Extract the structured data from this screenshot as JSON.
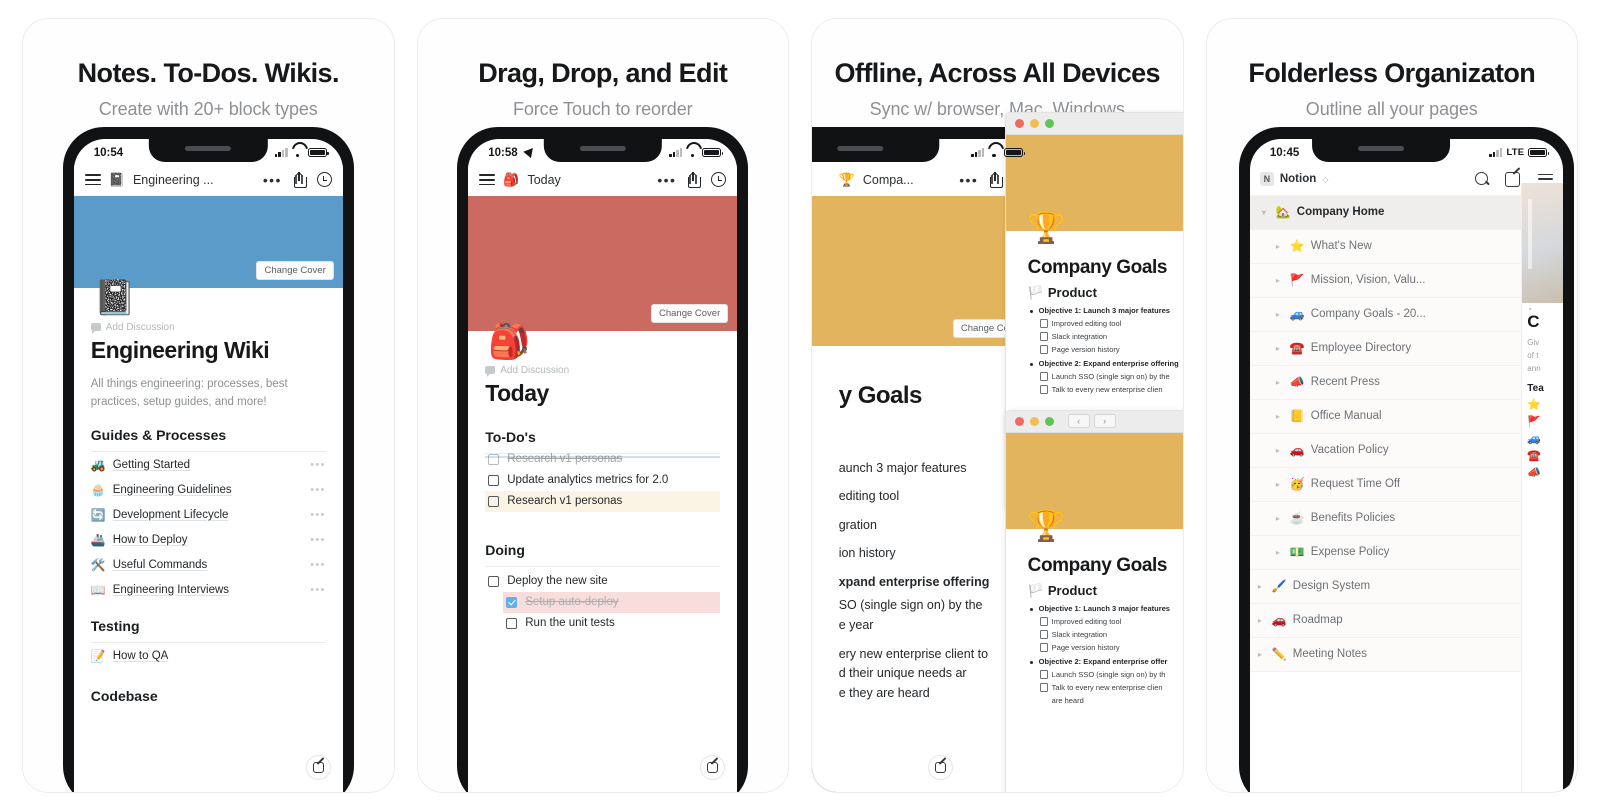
{
  "panels": [
    {
      "title": "Notes. To-Dos. Wikis.",
      "subtitle": "Create with 20+ block types",
      "phone": {
        "time": "10:54",
        "carrier_label": "",
        "nav_title": "Engineering ...",
        "nav_emoji": "📓",
        "cover_color": "#5b9bc9",
        "change_cover": "Change Cover",
        "page_emoji": "📓",
        "add_discussion": "Add Discussion",
        "page_title": "Engineering Wiki",
        "description": "All things engineering: processes, best practices, setup guides, and more!",
        "section1": "Guides & Processes",
        "links": [
          {
            "emoji": "🚜",
            "label": "Getting Started"
          },
          {
            "emoji": "🧁",
            "label": "Engineering Guidelines"
          },
          {
            "emoji": "🔄",
            "label": "Development Lifecycle"
          },
          {
            "emoji": "🚢",
            "label": "How to Deploy"
          },
          {
            "emoji": "🛠️",
            "label": "Useful Commands"
          },
          {
            "emoji": "📖",
            "label": "Engineering Interviews"
          }
        ],
        "section2": "Testing",
        "links2": [
          {
            "emoji": "📝",
            "label": "How to QA"
          }
        ],
        "section3": "Codebase"
      }
    },
    {
      "title": "Drag, Drop, and Edit",
      "subtitle": "Force Touch to reorder",
      "phone": {
        "time": "10:58",
        "nav_title": "Today",
        "nav_emoji": "🎒",
        "cover_color": "#cb6a61",
        "change_cover": "Change Cover",
        "page_emoji": "🎒",
        "add_discussion": "Add Discussion",
        "page_title": "Today",
        "section1": "To-Do's",
        "drag_ghost": "Research v1 personas",
        "todos1": [
          {
            "label": "Update analytics metrics for 2.0",
            "checked": false,
            "highlight": "none"
          },
          {
            "label": "Research v1 personas",
            "checked": false,
            "highlight": "yellow"
          }
        ],
        "section2": "Doing",
        "todos2": [
          {
            "label": "Deploy the new site",
            "checked": false,
            "highlight": "none",
            "indent": false
          },
          {
            "label": "Setup auto-deploy",
            "checked": true,
            "highlight": "red",
            "indent": true,
            "struck": true
          },
          {
            "label": "Run the unit tests",
            "checked": false,
            "highlight": "none",
            "indent": true
          }
        ]
      }
    },
    {
      "title": "Offline, Across All Devices",
      "subtitle": "Sync w/ browser, Mac, Windows",
      "phone": {
        "nav_title": "Compa...",
        "nav_emoji": "🏆",
        "cover_color": "#e3b45e",
        "change_cover": "Change Cover",
        "page_title_visible": "y Goals",
        "lines": [
          "aunch 3 major features",
          "editing tool",
          "gration",
          "ion history",
          "xpand enterprise offering",
          "SO (single sign on) by the",
          "e year",
          "ery new enterprise client to",
          "d their unique needs ar",
          "e they are heard"
        ]
      },
      "windows": [
        {
          "cover_color": "#e3b45e",
          "emoji": "🏆",
          "heading": "Company Goals",
          "sub_emoji": "🏳️",
          "subheading": "Product",
          "items": [
            {
              "type": "bullet",
              "text": "Objective 1: Launch 3 major features"
            },
            {
              "type": "check",
              "text": "Improved editing tool"
            },
            {
              "type": "check",
              "text": "Slack integration"
            },
            {
              "type": "check",
              "text": "Page version history"
            },
            {
              "type": "bullet",
              "text": "Objective 2: Expand enterprise offering"
            },
            {
              "type": "check",
              "text": "Launch SSO (single sign on) by the"
            },
            {
              "type": "check",
              "text": "Talk to every new enterprise clien"
            }
          ],
          "has_navbtns": false
        },
        {
          "cover_color": "#e3b45e",
          "emoji": "🏆",
          "heading": "Company Goals",
          "sub_emoji": "🏳️",
          "subheading": "Product",
          "back_label": "‹",
          "fwd_label": "›",
          "items": [
            {
              "type": "bullet",
              "text": "Objective 1: Launch 3 major features"
            },
            {
              "type": "check",
              "text": "Improved editing tool"
            },
            {
              "type": "check",
              "text": "Slack integration"
            },
            {
              "type": "check",
              "text": "Page version history"
            },
            {
              "type": "bullet",
              "text": "Objective 2: Expand enterprise offer"
            },
            {
              "type": "check",
              "text": "Launch SSO (single sign on) by th"
            },
            {
              "type": "check",
              "text": "Talk to every new enterprise clien"
            },
            {
              "type": "cont",
              "text": "are heard"
            }
          ],
          "has_navbtns": true
        }
      ]
    },
    {
      "title": "Folderless Organizaton",
      "subtitle": "Outline all your pages",
      "phone": {
        "time": "10:45",
        "carrier_label": "LTE",
        "workspace_badge": "N",
        "workspace_name": "Notion",
        "tree": [
          {
            "emoji": "🏡",
            "label": "Company Home",
            "level": 0,
            "root": true,
            "expanded": true
          },
          {
            "emoji": "⭐",
            "label": "What's New",
            "level": 1,
            "root": false,
            "expanded": false
          },
          {
            "emoji": "🚩",
            "label": "Mission, Vision, Valu...",
            "level": 1,
            "root": false,
            "expanded": false
          },
          {
            "emoji": "🚙",
            "label": "Company Goals - 20...",
            "level": 1,
            "root": false,
            "expanded": false
          },
          {
            "emoji": "☎️",
            "label": "Employee Directory",
            "level": 1,
            "root": false,
            "expanded": false
          },
          {
            "emoji": "📣",
            "label": "Recent Press",
            "level": 1,
            "root": false,
            "expanded": false
          },
          {
            "emoji": "📒",
            "label": "Office Manual",
            "level": 1,
            "root": false,
            "expanded": false
          },
          {
            "emoji": "🚗",
            "label": "Vacation Policy",
            "level": 1,
            "root": false,
            "expanded": false
          },
          {
            "emoji": "🥳",
            "label": "Request Time Off",
            "level": 1,
            "root": false,
            "expanded": false
          },
          {
            "emoji": "☕",
            "label": "Benefits Policies",
            "level": 1,
            "root": false,
            "expanded": false
          },
          {
            "emoji": "💵",
            "label": "Expense Policy",
            "level": 1,
            "root": false,
            "expanded": false
          },
          {
            "emoji": "🖌️",
            "label": "Design System",
            "level": 0,
            "root": false,
            "expanded": false
          },
          {
            "emoji": "🚗",
            "label": "Roadmap",
            "level": 0,
            "root": false,
            "expanded": false
          },
          {
            "emoji": "✏️",
            "label": "Meeting Notes",
            "level": 0,
            "root": false,
            "expanded": false
          }
        ],
        "peek": {
          "title": "C",
          "para_lines": [
            "Giv",
            "of t",
            "ann"
          ],
          "section": "Tea",
          "emojis": [
            "⭐",
            "🚩",
            "🚙",
            "☎️",
            "📣"
          ]
        }
      }
    }
  ],
  "icons": {
    "dots": "•••",
    "plus": "+",
    "caret_down": "▾",
    "caret_right": "▸",
    "chevron": "◇"
  }
}
